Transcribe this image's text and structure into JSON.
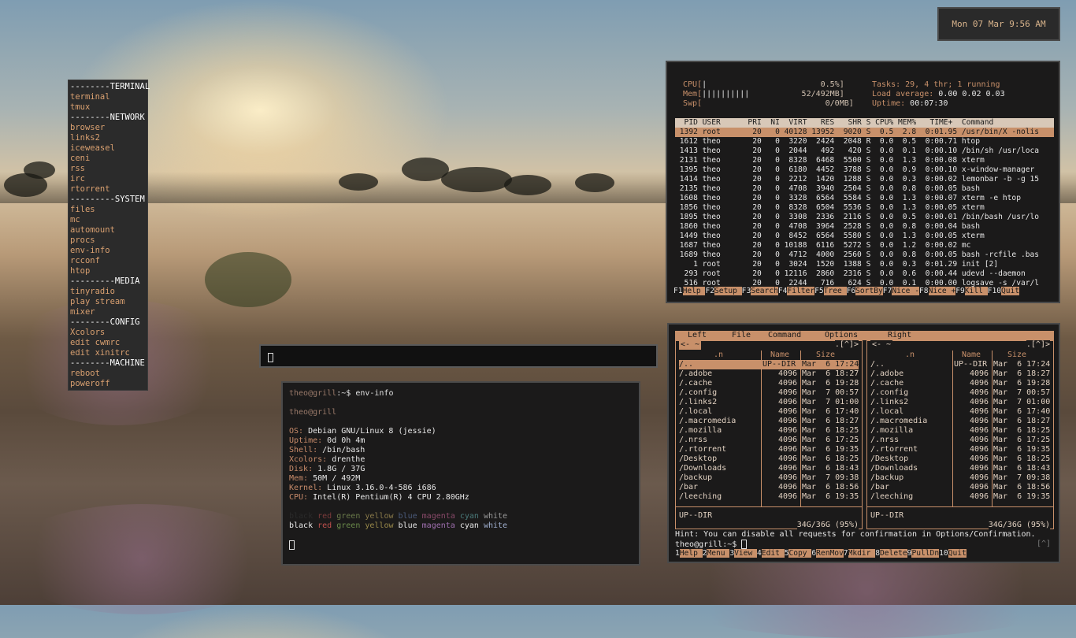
{
  "clock": {
    "text": "Mon 07 Mar  9:56 AM"
  },
  "menu": {
    "items": [
      {
        "label": "--------TERMINAL",
        "section": true
      },
      {
        "label": "terminal"
      },
      {
        "label": "tmux"
      },
      {
        "label": "--------NETWORK",
        "section": true
      },
      {
        "label": "browser"
      },
      {
        "label": "links2"
      },
      {
        "label": "iceweasel"
      },
      {
        "label": "ceni"
      },
      {
        "label": "rss"
      },
      {
        "label": "irc"
      },
      {
        "label": "rtorrent"
      },
      {
        "label": "---------SYSTEM",
        "section": true
      },
      {
        "label": "files"
      },
      {
        "label": "mc"
      },
      {
        "label": "automount"
      },
      {
        "label": "procs"
      },
      {
        "label": "env-info"
      },
      {
        "label": "rcconf"
      },
      {
        "label": "htop"
      },
      {
        "label": "---------MEDIA",
        "section": true
      },
      {
        "label": "tinyradio"
      },
      {
        "label": "play stream"
      },
      {
        "label": "mixer"
      },
      {
        "label": "--------CONFIG",
        "section": true
      },
      {
        "label": "Xcolors"
      },
      {
        "label": "edit cwmrc"
      },
      {
        "label": "edit xinitrc"
      },
      {
        "label": "--------MACHINE",
        "section": true
      },
      {
        "label": "reboot"
      },
      {
        "label": "poweroff"
      }
    ]
  },
  "terminal": {
    "prompt_user": "theo@grill",
    "prompt_rest": ":~$ ",
    "command": "env-info",
    "hostline": "theo@grill",
    "info": [
      {
        "label": "OS:",
        "value": " Debian GNU/Linux 8 (jessie)"
      },
      {
        "label": "Uptime:",
        "value": " 0d 0h 4m"
      },
      {
        "label": "Shell:",
        "value": " /bin/bash"
      },
      {
        "label": "Xcolors:",
        "value": " drenthe"
      },
      {
        "label": "Disk:",
        "value": " 1.8G / 37G"
      },
      {
        "label": "Mem:",
        "value": " 50M / 492M"
      },
      {
        "label": "Kernel:",
        "value": " Linux 3.16.0-4-586 i686"
      },
      {
        "label": "CPU:",
        "value": " Intel(R) Pentium(R) 4 CPU 2.80GHz"
      }
    ],
    "colors": [
      "black",
      "red",
      "green",
      "yellow",
      "blue",
      "magenta",
      "cyan",
      "white"
    ]
  },
  "htop": {
    "cpu_label": "CPU[",
    "cpu_bar": "|",
    "cpu_value": "0.5%]",
    "mem_label": "Mem[",
    "mem_bar": "||||||||||",
    "mem_value": "52/492MB]",
    "swp_label": "Swp[",
    "swp_value": "0/0MB]",
    "tasks_label": "Tasks:",
    "tasks_value": " 29, 4 thr; 1 running",
    "load_label": "Load average:",
    "load_value": " 0.00 0.02 0.03",
    "uptime_label": "Uptime:",
    "uptime_value": " 00:07:30",
    "header": "  PID USER      PRI  NI  VIRT   RES   SHR S CPU% MEM%   TIME+  Command",
    "rows": [
      " 1392 root       20   0 40128 13952  9020 S  0.5  2.8  0:01.95 /usr/bin/X -nolis",
      " 1612 theo       20   0  3220  2424  2048 R  0.0  0.5  0:00.71 htop",
      " 1413 theo       20   0  2044   492   420 S  0.0  0.1  0:00.10 /bin/sh /usr/loca",
      " 2131 theo       20   0  8328  6468  5500 S  0.0  1.3  0:00.08 xterm",
      " 1395 theo       20   0  6180  4452  3788 S  0.0  0.9  0:00.10 x-window-manager",
      " 1414 theo       20   0  2212  1420  1288 S  0.0  0.3  0:00.02 lemonbar -b -g 15",
      " 2135 theo       20   0  4708  3940  2504 S  0.0  0.8  0:00.05 bash",
      " 1608 theo       20   0  3328  6564  5584 S  0.0  1.3  0:00.07 xterm -e htop",
      " 1856 theo       20   0  8328  6504  5536 S  0.0  1.3  0:00.05 xterm",
      " 1895 theo       20   0  3308  2336  2116 S  0.0  0.5  0:00.01 /bin/bash /usr/lo",
      " 1860 theo       20   0  4708  3964  2528 S  0.0  0.8  0:00.04 bash",
      " 1449 theo       20   0  8452  6564  5580 S  0.0  1.3  0:00.05 xterm",
      " 1687 theo       20   0 10188  6116  5272 S  0.0  1.2  0:00.02 mc",
      " 1689 theo       20   0  4712  4000  2560 S  0.0  0.8  0:00.05 bash -rcfile .bas",
      "    1 root       20   0  3024  1520  1388 S  0.0  0.3  0:01.29 init [2]",
      "  293 root       20   0 12116  2860  2316 S  0.0  0.6  0:00.44 udevd --daemon",
      "  516 root       20   0  2244   716   624 S  0.0  0.1  0:00.00 logsave -s /var/l"
    ],
    "fkeys": [
      {
        "num": "F1",
        "label": "Help  "
      },
      {
        "num": "F2",
        "label": "Setup "
      },
      {
        "num": "F3",
        "label": "Search"
      },
      {
        "num": "F4",
        "label": "Filter"
      },
      {
        "num": "F5",
        "label": "Tree  "
      },
      {
        "num": "F6",
        "label": "SortBy"
      },
      {
        "num": "F7",
        "label": "Nice -"
      },
      {
        "num": "F8",
        "label": "Nice +"
      },
      {
        "num": "F9",
        "label": "Kill  "
      },
      {
        "num": "F10",
        "label": "Quit"
      }
    ]
  },
  "mc": {
    "menubar": [
      "Left",
      "File",
      "Command",
      "Options",
      "Right"
    ],
    "left_title": "<- ~",
    "right_title": "<- ~",
    "panel_corner": ".[^]>",
    "columns": {
      "name": ".n",
      "size": "Name",
      "date": "Size"
    },
    "files": [
      {
        "name": "/..",
        "size": "UP--DIR",
        "date": "Mar  6 17:24"
      },
      {
        "name": "/.adobe",
        "size": "4096",
        "date": "Mar  6 18:27"
      },
      {
        "name": "/.cache",
        "size": "4096",
        "date": "Mar  6 19:28"
      },
      {
        "name": "/.config",
        "size": "4096",
        "date": "Mar  7 00:57"
      },
      {
        "name": "/.links2",
        "size": "4096",
        "date": "Mar  7 01:00"
      },
      {
        "name": "/.local",
        "size": "4096",
        "date": "Mar  6 17:40"
      },
      {
        "name": "/.macromedia",
        "size": "4096",
        "date": "Mar  6 18:27"
      },
      {
        "name": "/.mozilla",
        "size": "4096",
        "date": "Mar  6 18:25"
      },
      {
        "name": "/.nrss",
        "size": "4096",
        "date": "Mar  6 17:25"
      },
      {
        "name": "/.rtorrent",
        "size": "4096",
        "date": "Mar  6 19:35"
      },
      {
        "name": "/Desktop",
        "size": "4096",
        "date": "Mar  6 18:25"
      },
      {
        "name": "/Downloads",
        "size": "4096",
        "date": "Mar  6 18:43"
      },
      {
        "name": "/backup",
        "size": "4096",
        "date": "Mar  7 09:38"
      },
      {
        "name": "/bar",
        "size": "4096",
        "date": "Mar  6 18:56"
      },
      {
        "name": "/leeching",
        "size": "4096",
        "date": "Mar  6 19:35"
      }
    ],
    "status": "UP--DIR",
    "free": "34G/36G (95%)",
    "hint": "Hint: You can disable all requests for confirmation in Options/Confirmation.",
    "prompt": "theo@grill:~$ ",
    "history": "[^]",
    "fkeys": [
      {
        "num": "1",
        "label": "Help  "
      },
      {
        "num": "2",
        "label": "Menu  "
      },
      {
        "num": "3",
        "label": "View  "
      },
      {
        "num": "4",
        "label": "Edit  "
      },
      {
        "num": "5",
        "label": "Copy  "
      },
      {
        "num": "6",
        "label": "RenMov"
      },
      {
        "num": "7",
        "label": "Mkdir "
      },
      {
        "num": "8",
        "label": "Delete"
      },
      {
        "num": "9",
        "label": "PullDn"
      },
      {
        "num": "10",
        "label": "Quit"
      }
    ]
  }
}
